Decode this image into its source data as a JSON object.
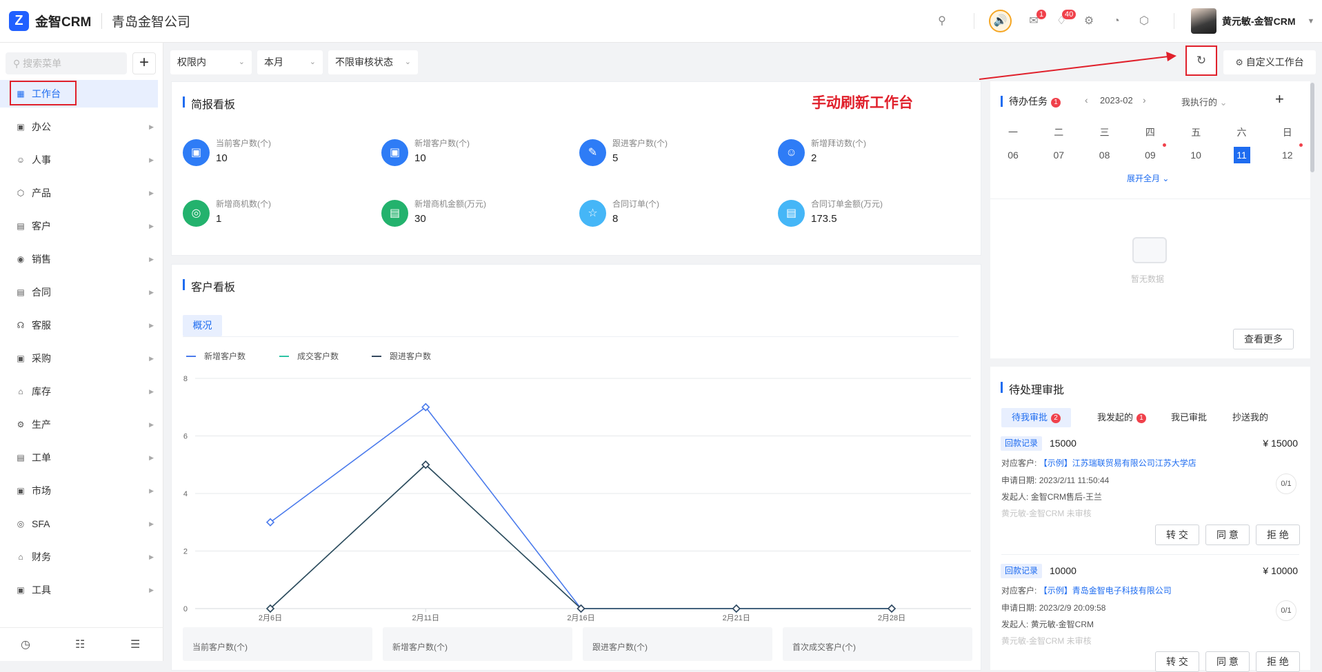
{
  "header": {
    "brand": "金智CRM",
    "company": "青岛金智公司",
    "mail_badge": "1",
    "bell_badge": "40",
    "user_name": "黄元敏-金智CRM"
  },
  "sidebar": {
    "search_placeholder": "搜索菜单",
    "items": [
      {
        "label": "工作台",
        "icon": "dashboard-icon"
      },
      {
        "label": "办公",
        "icon": "office-icon"
      },
      {
        "label": "人事",
        "icon": "people-icon"
      },
      {
        "label": "产品",
        "icon": "product-icon"
      },
      {
        "label": "客户",
        "icon": "customer-icon"
      },
      {
        "label": "销售",
        "icon": "sales-icon"
      },
      {
        "label": "合同",
        "icon": "contract-icon"
      },
      {
        "label": "客服",
        "icon": "headset-icon"
      },
      {
        "label": "采购",
        "icon": "purchase-icon"
      },
      {
        "label": "库存",
        "icon": "warehouse-icon"
      },
      {
        "label": "生产",
        "icon": "production-icon"
      },
      {
        "label": "工单",
        "icon": "ticket-icon"
      },
      {
        "label": "市场",
        "icon": "market-icon"
      },
      {
        "label": "SFA",
        "icon": "sfa-icon"
      },
      {
        "label": "财务",
        "icon": "finance-icon"
      },
      {
        "label": "工具",
        "icon": "tools-icon"
      }
    ]
  },
  "filters": {
    "scope": "权限内",
    "period": "本月",
    "review": "不限审核状态"
  },
  "toolbar": {
    "customize_label": "自定义工作台"
  },
  "annotation": "手动刷新工作台",
  "briefing": {
    "title": "简报看板",
    "stats": [
      {
        "label": "当前客户数(个)",
        "value": "10",
        "color": "#2e7cf6",
        "icon": "building-icon"
      },
      {
        "label": "新增客户数(个)",
        "value": "10",
        "color": "#2e7cf6",
        "icon": "building-icon"
      },
      {
        "label": "跟进客户数(个)",
        "value": "5",
        "color": "#2e7cf6",
        "icon": "edit-icon"
      },
      {
        "label": "新增拜访数(个)",
        "value": "2",
        "color": "#2e7cf6",
        "icon": "users-icon"
      },
      {
        "label": "新增商机数(个)",
        "value": "1",
        "color": "#23b26d",
        "icon": "target-icon"
      },
      {
        "label": "新增商机金额(万元)",
        "value": "30",
        "color": "#23b26d",
        "icon": "money-doc-icon"
      },
      {
        "label": "合同订单(个)",
        "value": "8",
        "color": "#45b6f7",
        "icon": "order-icon"
      },
      {
        "label": "合同订单金额(万元)",
        "value": "173.5",
        "color": "#45b6f7",
        "icon": "contract-money-icon"
      }
    ]
  },
  "customer_board": {
    "title": "客户看板",
    "tab": "概况",
    "mini_cards": [
      "当前客户数(个)",
      "新增客户数(个)",
      "跟进客户数(个)",
      "首次成交客户(个)"
    ]
  },
  "chart_data": {
    "type": "line",
    "categories": [
      "2月6日",
      "2月11日",
      "2月16日",
      "2月21日",
      "2月28日"
    ],
    "ylim": [
      0,
      8
    ],
    "yticks": [
      0,
      2,
      4,
      6,
      8
    ],
    "grid": true,
    "legend_position": "top-left",
    "series": [
      {
        "name": "新增客户数",
        "color": "#4b7bec",
        "values": [
          3,
          7,
          0,
          0,
          0
        ]
      },
      {
        "name": "成交客户数",
        "color": "#2ec4a5",
        "values": [
          0,
          5,
          0,
          0,
          0
        ]
      },
      {
        "name": "跟进客户数",
        "color": "#34495e",
        "values": [
          0,
          5,
          0,
          0,
          0
        ]
      }
    ]
  },
  "tasks": {
    "title": "待办任务",
    "badge": "1",
    "month": "2023-02",
    "filter": "我执行的",
    "weekdays": [
      "一",
      "二",
      "三",
      "四",
      "五",
      "六",
      "日"
    ],
    "days": [
      "06",
      "07",
      "08",
      "09",
      "10",
      "11",
      "12"
    ],
    "expand": "展开全月",
    "empty": "暂无数据",
    "more": "查看更多"
  },
  "approvals": {
    "title": "待处理审批",
    "tabs": [
      {
        "label": "待我审批",
        "badge": "2"
      },
      {
        "label": "我发起的",
        "badge": "1"
      },
      {
        "label": "我已审批",
        "badge": ""
      },
      {
        "label": "抄送我的",
        "badge": ""
      }
    ],
    "items": [
      {
        "tag": "回款记录",
        "amount": "15000",
        "money": "¥ 15000",
        "customer_label": "对应客户:",
        "customer": "【示例】江苏瑞联贸易有限公司江苏大学店",
        "date_label": "申请日期:",
        "date": "2023/2/11 11:50:44",
        "initiator_label": "发起人:",
        "initiator": "金智CRM售后-王兰",
        "status": "黄元敏-金智CRM 未审核",
        "progress": "0/1"
      },
      {
        "tag": "回款记录",
        "amount": "10000",
        "money": "¥ 10000",
        "customer_label": "对应客户:",
        "customer": "【示例】青岛金智电子科技有限公司",
        "date_label": "申请日期:",
        "date": "2023/2/9 20:09:58",
        "initiator_label": "发起人:",
        "initiator": "黄元敏-金智CRM",
        "status": "黄元敏-金智CRM 未审核",
        "progress": "0/1"
      }
    ],
    "actions": {
      "transfer": "转 交",
      "agree": "同 意",
      "reject": "拒 绝"
    }
  }
}
